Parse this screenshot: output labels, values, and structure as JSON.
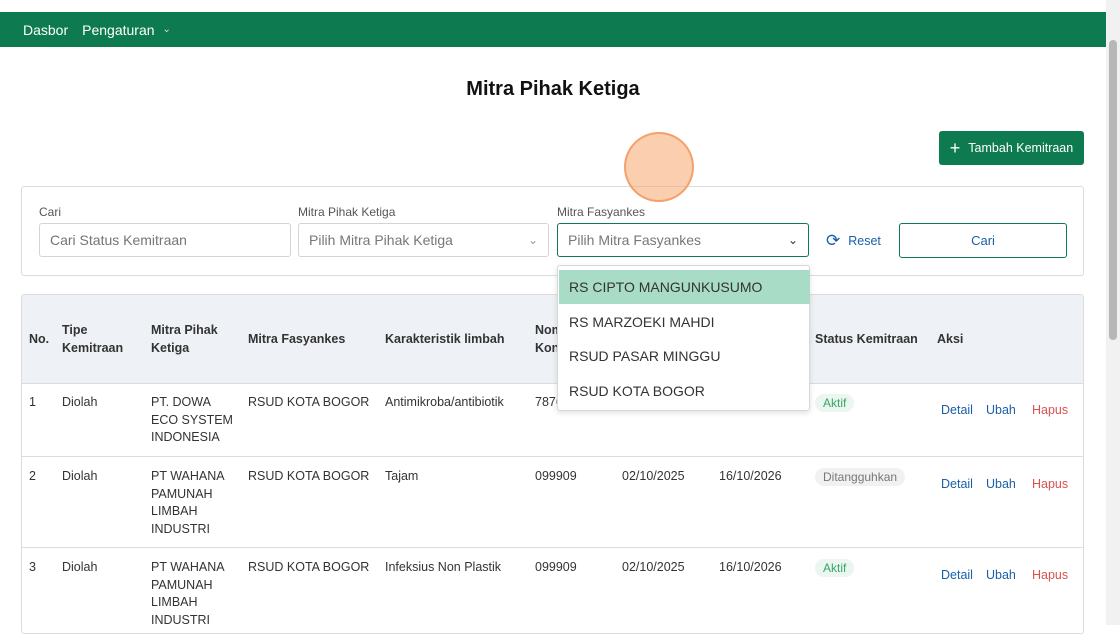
{
  "nav": {
    "items": [
      {
        "label": "Dasbor"
      },
      {
        "label": "Pengaturan"
      }
    ]
  },
  "page": {
    "title": "Mitra Pihak Ketiga",
    "add_button": "Tambah Kemitraan"
  },
  "filters": {
    "search": {
      "label": "Cari",
      "placeholder": "Cari Status Kemitraan",
      "value": ""
    },
    "mitra_pihak_ketiga": {
      "label": "Mitra Pihak Ketiga",
      "placeholder": "Pilih Mitra Pihak Ketiga"
    },
    "mitra_fasyankes": {
      "label": "Mitra Fasyankes",
      "placeholder": "Pilih Mitra Fasyankes"
    },
    "reset_label": "Reset",
    "search_button": "Cari"
  },
  "dropdown": {
    "options": [
      "RS CIPTO MANGUNKUSUMO",
      "RS MARZOEKI MAHDI",
      "RSUD PASAR MINGGU",
      "RSUD KOTA BOGOR"
    ],
    "highlighted_index": 0
  },
  "table": {
    "headers": {
      "no": "No.",
      "tipe": [
        "Tipe",
        "Kemitraan"
      ],
      "mitra_pihak": [
        "Mitra Pihak",
        "Ketiga"
      ],
      "mitra_fasyankes": "Mitra Fasyankes",
      "karakteristik": "Karakteristik limbah",
      "nomor": [
        "Nom",
        "Kon"
      ],
      "status": "Status Kemitraan",
      "aksi": "Aksi"
    },
    "actions": {
      "detail": "Detail",
      "ubah": "Ubah",
      "hapus": "Hapus"
    },
    "rows": [
      {
        "no": "1",
        "tipe": "Diolah",
        "mitra_pihak": [
          "PT. DOWA",
          "ECO SYSTEM",
          "INDONESIA"
        ],
        "mitra_fasyankes": "RSUD KOTA BOGOR",
        "karakteristik": "Antimikroba/antibiotik",
        "nomor": "7876",
        "tgl_mulai": "",
        "tgl_akhir": "",
        "status": "Aktif"
      },
      {
        "no": "2",
        "tipe": "Diolah",
        "mitra_pihak": [
          "PT WAHANA",
          "PAMUNAH",
          "LIMBAH",
          "INDUSTRI"
        ],
        "mitra_fasyankes": "RSUD KOTA BOGOR",
        "karakteristik": "Tajam",
        "nomor": "099909",
        "tgl_mulai": "02/10/2025",
        "tgl_akhir": "16/10/2026",
        "status": "Ditangguhkan"
      },
      {
        "no": "3",
        "tipe": "Diolah",
        "mitra_pihak": [
          "PT WAHANA",
          "PAMUNAH",
          "LIMBAH",
          "INDUSTRI"
        ],
        "mitra_fasyankes": "RSUD KOTA BOGOR",
        "karakteristik": "Infeksius Non Plastik",
        "nomor": "099909",
        "tgl_mulai": "02/10/2025",
        "tgl_akhir": "16/10/2026",
        "status": "Aktif"
      }
    ]
  },
  "colors": {
    "brand": "#0e7a4f",
    "link": "#1a5fa8",
    "danger": "#d9534f",
    "highlight": "#a8dcc6"
  }
}
